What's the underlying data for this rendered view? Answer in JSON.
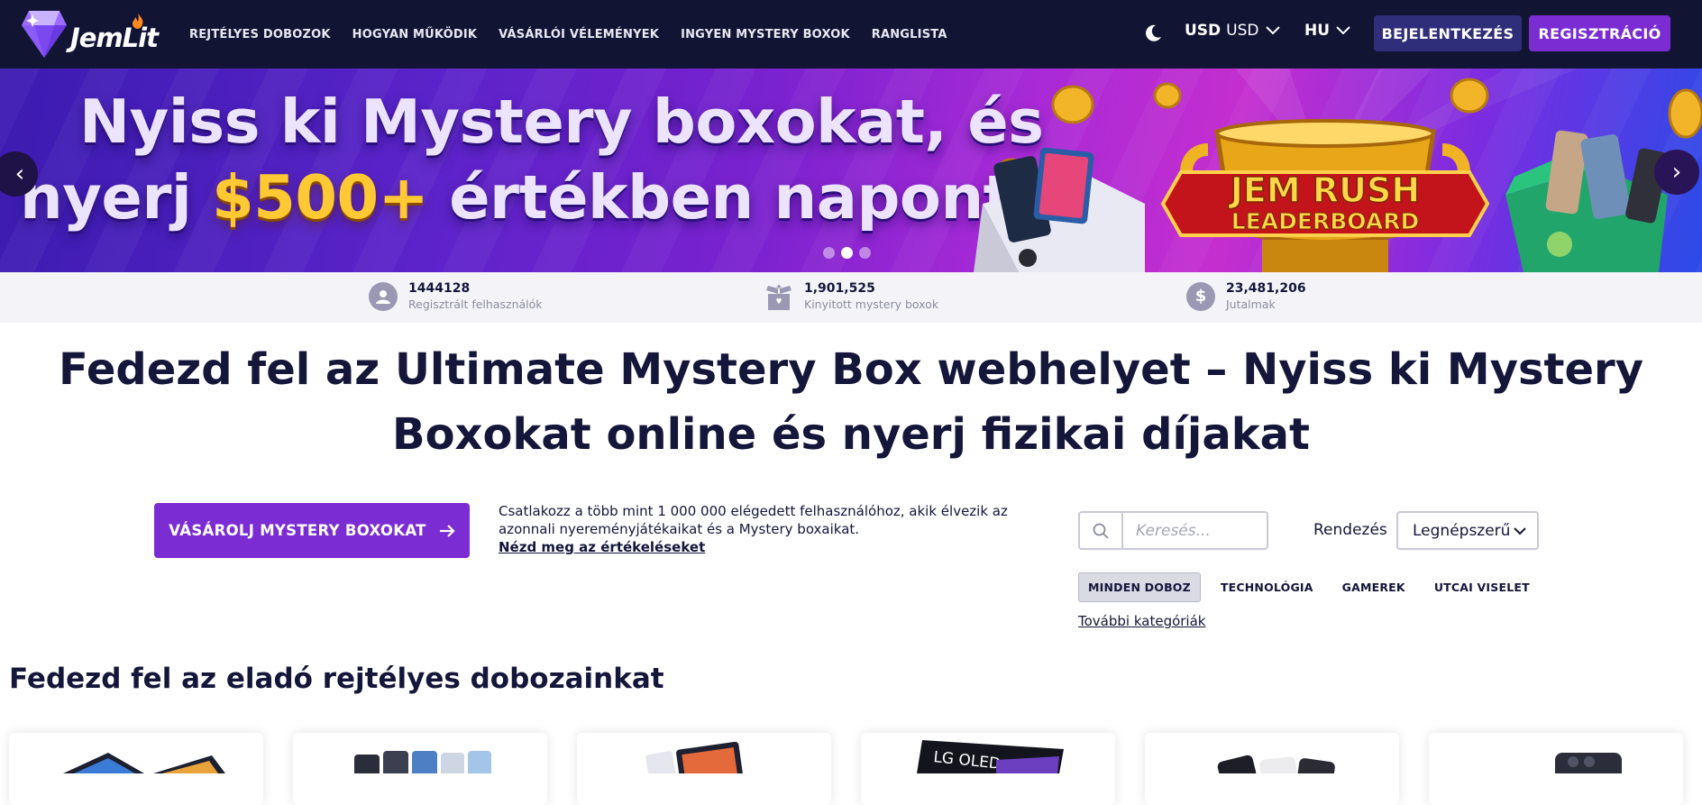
{
  "brand": {
    "name": "JemLit"
  },
  "nav": {
    "links": [
      "REJTÉLYES DOBOZOK",
      "HOGYAN MŰKÖDIK",
      "VÁSÁRLÓI VÉLEMÉNYEK",
      "INGYEN MYSTERY BOXOK",
      "RANGLISTA"
    ],
    "currency_bold": "USD",
    "currency": "USD",
    "language": "HU",
    "login": "BEJELENTKEZÉS",
    "register": "REGISZTRÁCIÓ"
  },
  "banner": {
    "line1": "Nyiss ki Mystery boxokat, és",
    "line2_pre": "nyerj ",
    "line2_gold": "$500+",
    "line2_post": " értékben naponta",
    "trophy_line1": "JEM RUSH",
    "trophy_line2": "LEADERBOARD",
    "prev": "‹",
    "next": "›",
    "active_slide": 2,
    "slide_count": 3
  },
  "stats": [
    {
      "value": "1444128",
      "label": "Regisztrált felhasználók",
      "icon": "user-icon"
    },
    {
      "value": "1,901,525",
      "label": "Kinyitott mystery boxok",
      "icon": "open-box-icon"
    },
    {
      "value": "23,481,206",
      "label": "Jutalmak",
      "icon": "dollar-icon"
    }
  ],
  "headline": {
    "bold": "Fedezd fel az Ultimate Mystery Box webhelyet",
    "rest": " – Nyiss ki Mystery Boxokat online és nyerj fizikai díjakat"
  },
  "cta": {
    "button": "VÁSÁROLJ MYSTERY BOXOKAT",
    "text": "Csatlakozz a több mint 1 000 000 elégedett felhasználóhoz, akik élvezik az azonnali nyereményjátékaikat és a Mystery boxaikat.",
    "link": "Nézd meg az értékeléseket"
  },
  "search": {
    "placeholder": "Keresés..."
  },
  "sort": {
    "label": "Rendezés",
    "value": "Legnépszerű"
  },
  "categories": {
    "items": [
      "MINDEN DOBOZ",
      "TECHNOLÓGIA",
      "GAMEREK",
      "UTCAI VISELET"
    ],
    "active": "MINDEN DOBOZ",
    "more": "További kategóriák"
  },
  "section": {
    "title": "Fedezd fel az eladó rejtélyes dobozainkat"
  },
  "cards": [
    {
      "art": "laptops"
    },
    {
      "art": "phones"
    },
    {
      "art": "tablets"
    },
    {
      "art": "lg-oled-tv",
      "label": "LG OLED"
    },
    {
      "art": "phones-dark"
    },
    {
      "art": "foldable-phone"
    }
  ],
  "colors": {
    "nav_bg": "#121434",
    "primary": "#7b2cd3",
    "login_bg": "#2f2e7a",
    "gold": "#ffc933",
    "text_dark": "#14163a"
  }
}
